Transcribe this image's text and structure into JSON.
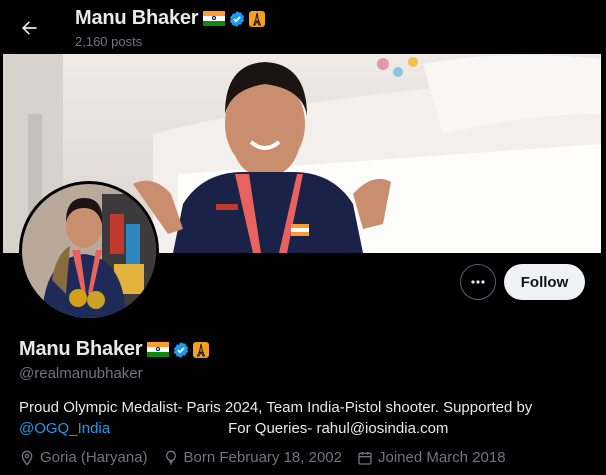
{
  "header": {
    "name": "Manu Bhaker",
    "posts_count": "2,160 posts",
    "back_icon": "arrow-left-icon"
  },
  "profile": {
    "display_name": "Manu Bhaker",
    "handle": "@realmanubhaker",
    "bio_line1": "Proud Olympic Medalist- Paris 2024, Team India-Pistol shooter. Supported by",
    "bio_mention": "@OGQ_India",
    "bio_queries": "For Queries- rahul@iosindia.com",
    "location": "Goria (Haryana)",
    "birthday": "Born February 18, 2002",
    "joined": "Joined March 2018",
    "badges": [
      "india-flag-icon",
      "verified-badge-icon",
      "eiffel-tower-icon"
    ]
  },
  "actions": {
    "more_label": "⋯",
    "follow_label": "Follow"
  },
  "colors": {
    "background": "#000000",
    "text": "#e7e9ea",
    "muted": "#71767b",
    "link": "#1d9bf0",
    "verified": "#1d9bf0",
    "follow_bg": "#eff3f4",
    "tower_badge": "#f4a21b"
  }
}
